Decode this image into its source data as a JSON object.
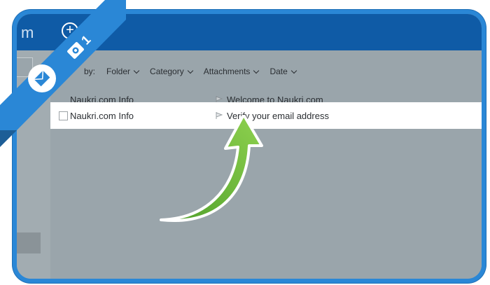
{
  "app": {
    "title_fragment": "m"
  },
  "toolbar": {
    "new_icon": "plus-circle-icon"
  },
  "filters": {
    "prefix": "by:",
    "items": [
      "Folder",
      "Category",
      "Attachments",
      "Date"
    ]
  },
  "messages": [
    {
      "sender": "Naukri.com Info",
      "subject": "Welcome to Naukri.com",
      "selected": false
    },
    {
      "sender": "Naukri.com Info",
      "subject": "Verify your email address",
      "selected": true
    }
  ],
  "badge": {
    "step": "1",
    "icons": [
      "envelope-icon",
      "camera-icon"
    ]
  },
  "colors": {
    "frame": "#2a87d6",
    "topbar": "#0f5ba6",
    "arrow": "#6ec23a",
    "overlay": "#9aa5ab"
  }
}
